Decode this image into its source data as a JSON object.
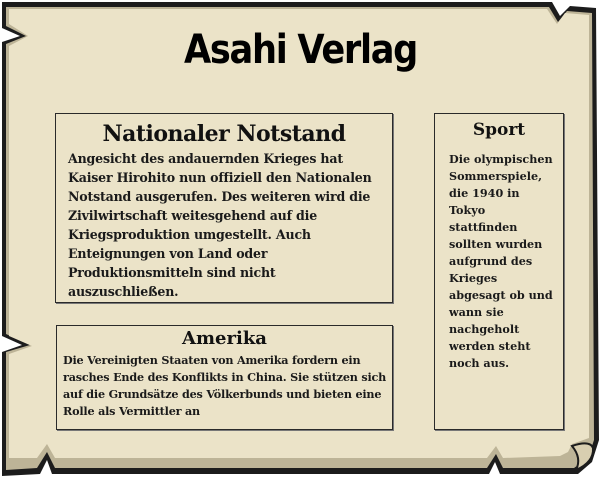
{
  "newspaper": {
    "title": "Asahi Verlag"
  },
  "articles": {
    "main": {
      "headline": "Nationaler Notstand",
      "body": "Angesicht des andauernden Krieges hat Kaiser Hirohito nun offiziell den Nationalen Notstand ausgerufen. Des weiteren wird die Zivilwirtschaft weitesgehend auf die Kriegsproduktion umgestellt. Auch Enteignungen von Land oder Produktionsmitteln sind nicht auszuschließen."
    },
    "amerika": {
      "headline": "Amerika",
      "body": "Die Vereinigten Staaten von Amerika fordern ein rasches Ende des Konflikts in China. Sie stützen sich auf die Grundsätze des Völkerbunds und bieten eine Rolle als Vermittler an"
    },
    "sport": {
      "headline": "Sport",
      "body": "Die olympischen Sommerspiele, die 1940 in Tokyo stattfinden sollten wurden aufgrund des Krieges abgesagt ob und wann sie nachgeholt werden steht noch aus."
    }
  },
  "colors": {
    "parchment": "#ebe3c8",
    "border": "#2a2a2a",
    "shadow": "#bdb497"
  }
}
